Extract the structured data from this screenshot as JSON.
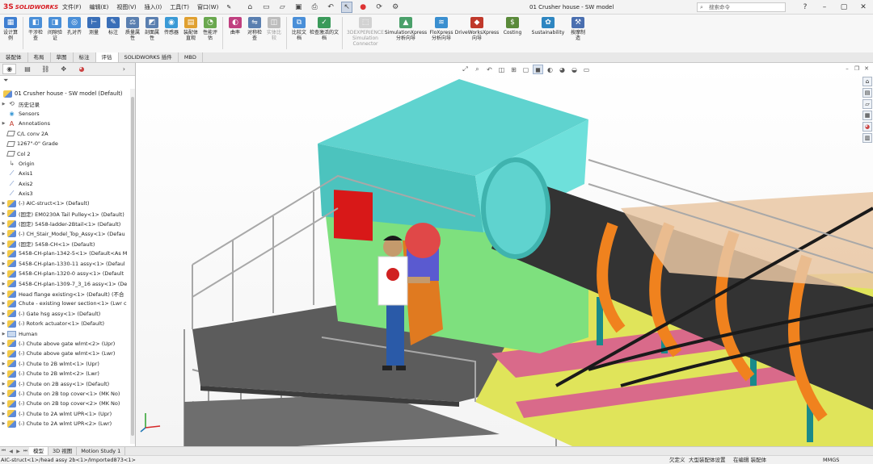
{
  "app": {
    "logo_mark": "3S",
    "logo_text": "SOLIDWORKS",
    "document_title": "01 Crusher house - SW model"
  },
  "menu": [
    "文件(F)",
    "编辑(E)",
    "视图(V)",
    "插入(I)",
    "工具(T)",
    "窗口(W)"
  ],
  "search": {
    "placeholder": "搜索命令"
  },
  "ribbon": {
    "buttons": [
      {
        "label": "设计算例",
        "color": "#3f7fd1",
        "icon": "design-study-icon"
      },
      {
        "label": "干涉检查",
        "color": "#4a8fd8",
        "icon": "interference-icon"
      },
      {
        "label": "间隙验证",
        "color": "#4a8fd8",
        "icon": "clearance-icon"
      },
      {
        "label": "孔对齐",
        "color": "#4a8fd8",
        "icon": "hole-alignment-icon"
      },
      {
        "label": "测量",
        "color": "#3a6fb8",
        "icon": "measure-icon"
      },
      {
        "label": "标注",
        "color": "#3a6fb8",
        "icon": "markup-icon"
      },
      {
        "label": "质量属性",
        "color": "#5a7fb0",
        "icon": "mass-properties-icon"
      },
      {
        "label": "剖面属性",
        "color": "#5a7fb0",
        "icon": "section-properties-icon"
      },
      {
        "label": "传感器",
        "color": "#3a9ad6",
        "icon": "sensor-icon"
      },
      {
        "label": "装配体直观",
        "color": "#e0a030",
        "icon": "assembly-visualization-icon"
      },
      {
        "label": "性能评估",
        "color": "#6aa84f",
        "icon": "performance-icon"
      },
      {
        "label": "曲率",
        "color": "#c04080",
        "icon": "curvature-icon"
      },
      {
        "label": "对称检查",
        "color": "#5a7fb0",
        "icon": "symmetry-icon"
      },
      {
        "label": "实体比较",
        "color": "#9a9a9a",
        "icon": "compare-body-icon",
        "disabled": true
      },
      {
        "label": "比较文档",
        "color": "#4a8fd8",
        "icon": "compare-docs-icon"
      },
      {
        "label": "检查激活的文档",
        "color": "#3a9a5a",
        "icon": "check-doc-icon"
      },
      {
        "label": "3DEXPERIENCE Simulation Connector",
        "color": "#b0b0b0",
        "icon": "3dx-connector-icon",
        "disabled": true
      },
      {
        "label": "SimulationXpress 分析向导",
        "color": "#4aa06a",
        "icon": "simxpress-icon"
      },
      {
        "label": "FloXpress 分析向导",
        "color": "#3a8fd0",
        "icon": "floxpress-icon"
      },
      {
        "label": "DriveWorksXpress 向导",
        "color": "#c0392b",
        "icon": "driveworks-icon"
      },
      {
        "label": "Costing",
        "color": "#5a8a3a",
        "icon": "costing-icon"
      },
      {
        "label": "Sustainability",
        "color": "#2e86c1",
        "icon": "sustainability-icon"
      },
      {
        "label": "按摩制造",
        "color": "#4a6fb0",
        "icon": "manufacture-icon"
      }
    ]
  },
  "command_tabs": [
    {
      "label": "装配体",
      "active": false
    },
    {
      "label": "布局",
      "active": false
    },
    {
      "label": "草图",
      "active": false
    },
    {
      "label": "标注",
      "active": false
    },
    {
      "label": "评估",
      "active": true
    },
    {
      "label": "SOLIDWORKS 插件",
      "active": false
    },
    {
      "label": "MBD",
      "active": false
    }
  ],
  "tree": {
    "root": "01 Crusher house - SW model  (Default)",
    "items": [
      {
        "label": "历史记录",
        "icon": "hist",
        "expand": "▶"
      },
      {
        "label": "Sensors",
        "icon": "sensor",
        "expand": ""
      },
      {
        "label": "Annotations",
        "icon": "anno",
        "expand": "▶"
      },
      {
        "label": "C/L conv 2A",
        "icon": "plane",
        "expand": ""
      },
      {
        "label": "1267\"-0\" Grade",
        "icon": "plane",
        "expand": ""
      },
      {
        "label": "Col 2",
        "icon": "plane",
        "expand": ""
      },
      {
        "label": "Origin",
        "icon": "origin",
        "expand": ""
      },
      {
        "label": "Axis1",
        "icon": "axis",
        "expand": ""
      },
      {
        "label": "Axis2",
        "icon": "axis",
        "expand": ""
      },
      {
        "label": "Axis3",
        "icon": "axis",
        "expand": ""
      },
      {
        "label": "(-) AIC-struct<1> (Default)",
        "icon": "part",
        "expand": "▶"
      },
      {
        "label": "(固定) EM0230A Tail Pulley<1> (Default)",
        "icon": "part",
        "expand": "▶"
      },
      {
        "label": "(固定) 5458-ladder-2Btail<1> (Default)",
        "icon": "part",
        "expand": "▶"
      },
      {
        "label": "(-) CH_Stair_Model_Top_Assy<1> (Defau",
        "icon": "part",
        "expand": "▶"
      },
      {
        "label": "(固定) 5458-CH<1> (Default)",
        "icon": "part",
        "expand": "▶"
      },
      {
        "label": "5458-CH-plan-1342-5<1> (Default<As M",
        "icon": "part",
        "expand": "▶"
      },
      {
        "label": "5458-CH-plan-1330-11 assy<1> (Defaul",
        "icon": "part",
        "expand": "▶"
      },
      {
        "label": "5458-CH-plan-1320-0 assy<1> (Default",
        "icon": "part",
        "expand": "▶"
      },
      {
        "label": "5458-CH-plan-1309-7_3_16 assy<1> (De",
        "icon": "part",
        "expand": "▶"
      },
      {
        "label": "Head flange existing<1> (Default) (不合",
        "icon": "part",
        "expand": "▶"
      },
      {
        "label": "Chute - existing lower section<1> (Lwr c",
        "icon": "part",
        "expand": "▶"
      },
      {
        "label": "(-) Gate hsg assy<1> (Default)",
        "icon": "part",
        "expand": "▶"
      },
      {
        "label": "(-) Rotork actuator<1> (Default)",
        "icon": "part",
        "expand": "▶"
      },
      {
        "label": "Human",
        "icon": "folder",
        "expand": "▶"
      },
      {
        "label": "(-) Chute above gate wlmt<2> (Upr)",
        "icon": "part",
        "expand": "▶"
      },
      {
        "label": "(-) Chute above gate wlmt<1> (Lwr)",
        "icon": "part",
        "expand": "▶"
      },
      {
        "label": "(-) Chute to 2B wlmt<1> (Upr)",
        "icon": "part",
        "expand": "▶"
      },
      {
        "label": "(-) Chute to 2B wlmt<2> (Lwr)",
        "icon": "part",
        "expand": "▶"
      },
      {
        "label": "(-) Chute on 2B assy<1> (Default)",
        "icon": "part",
        "expand": "▶"
      },
      {
        "label": "(-) Chute on 2B top cover<1> (MK No)",
        "icon": "part",
        "expand": "▶"
      },
      {
        "label": "(-) Chute on 2B top cover<2> (MK No)",
        "icon": "part",
        "expand": "▶"
      },
      {
        "label": "(-) Chute to 2A wlmt UPR<1> (Upr)",
        "icon": "part",
        "expand": "▶"
      },
      {
        "label": "(-) Chute to 2A wlmt UPR<2> (Lwr)",
        "icon": "part",
        "expand": "▶"
      }
    ]
  },
  "bottom_tabs": [
    {
      "label": "模型",
      "active": true
    },
    {
      "label": "3D 视图",
      "active": false
    },
    {
      "label": "Motion Study 1",
      "active": false
    }
  ],
  "status": {
    "message": "AIC-struct<1>/head assy 2b<1>/Imported873<1>",
    "state1": "欠定义",
    "state2": "大型装配体设置",
    "state3": "在编辑 装配体",
    "units": "MMGS"
  },
  "colors": {
    "accent": "#d71920",
    "motor_housing": "#5fd3cf",
    "platform_green": "#7ee07e",
    "conveyor_orange": "#f0821e",
    "belt_cover_tan": "#e9c7a3",
    "structure_yellow": "#e0e45a",
    "gearbox_blue": "#5a5ad0"
  }
}
